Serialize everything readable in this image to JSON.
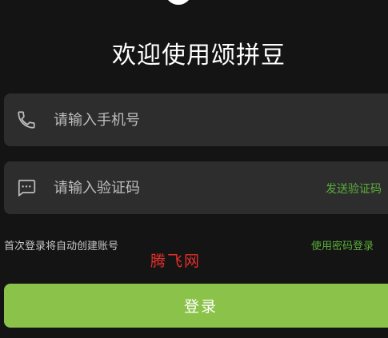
{
  "page": {
    "title": "欢迎使用颂拼豆"
  },
  "phone_field": {
    "icon": "phone-icon",
    "placeholder": "请输入手机号",
    "value": ""
  },
  "code_field": {
    "icon": "message-icon",
    "placeholder": "请输入验证码",
    "value": "",
    "send_code_label": "发送验证码"
  },
  "hint": {
    "first_login": "首次登录将自动创建账号",
    "password_login": "使用密码登录"
  },
  "watermark": "腾飞网",
  "login_button": {
    "label": "登录"
  },
  "colors": {
    "background": "#141414",
    "field_background": "#2d2d2d",
    "accent_green": "#5aae3c",
    "button_green": "#8bc34a",
    "watermark_red": "#e0302a"
  }
}
